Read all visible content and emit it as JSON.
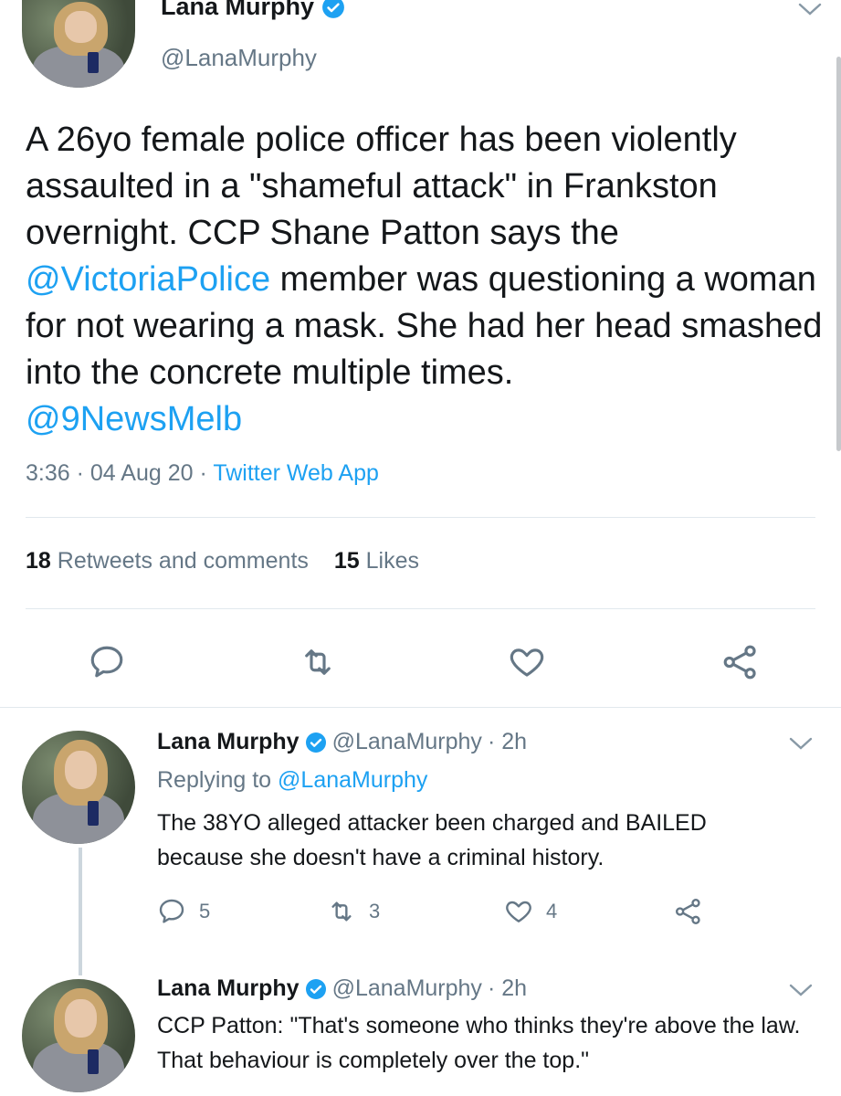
{
  "colors": {
    "accent": "#1da1f2",
    "muted": "#657786",
    "text": "#14171a"
  },
  "main_tweet": {
    "name": "Lana Murphy",
    "handle": "@LanaMurphy",
    "text_parts": {
      "p1": "A 26yo female police officer has been violently assaulted in a \"shameful attack\" in Frankston overnight. CCP Shane Patton says the ",
      "mention1": "@VictoriaPolice",
      "p2": " member was questioning a woman for not wearing a mask. She had her head smashed into the concrete multiple times.",
      "mention2": "@9NewsMelb"
    },
    "time": "3:36",
    "date": "04 Aug 20",
    "app": "Twitter Web App",
    "retweets_count": "18",
    "retweets_label": "Retweets and comments",
    "likes_count": "15",
    "likes_label": "Likes",
    "icons": [
      "reply-icon",
      "retweet-icon",
      "like-icon",
      "share-icon"
    ]
  },
  "replies": [
    {
      "name": "Lana Murphy",
      "handle": "@LanaMurphy",
      "age": "· 2h",
      "replying_prefix": "Replying to",
      "replying_to": "@LanaMurphy",
      "text": "The 38YO alleged attacker been charged and BAILED because she doesn't have a criminal history.",
      "reply_count": "5",
      "retweet_count": "3",
      "like_count": "4"
    },
    {
      "name": "Lana Murphy",
      "handle": "@LanaMurphy",
      "age": "· 2h",
      "text": "CCP Patton: \"That's someone who thinks they're above the law. That behaviour is completely over the top.\""
    }
  ]
}
